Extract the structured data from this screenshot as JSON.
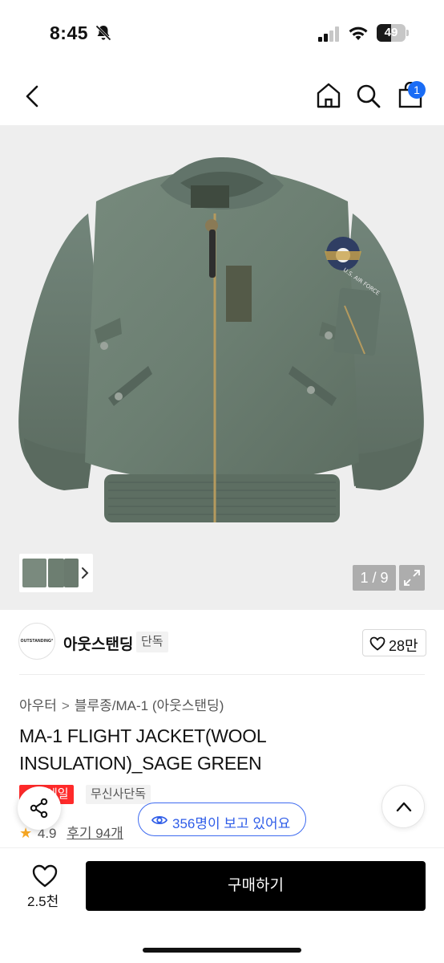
{
  "status_bar": {
    "time": "8:45",
    "battery": "49",
    "battery_level": 0.49
  },
  "nav": {
    "cart_count": "1",
    "accent_color": "#1a6cf5"
  },
  "gallery": {
    "counter": "1 / 9"
  },
  "brand": {
    "logo_text": "OUTSTANDING°",
    "name": "아웃스탠딩",
    "exclusive_badge": "단독",
    "likes": "28만"
  },
  "breadcrumb": {
    "level1": "아우터",
    "separator": ">",
    "level2": "블루종/MA-1 (아웃스탠딩)"
  },
  "product": {
    "title": "MA-1 FLIGHT JACKET(WOOL INSULATION)_SAGE GREEN",
    "sale_tag": "세일",
    "exclusive_tag": "무신사단독",
    "rating_star": "★",
    "rating": "4.9",
    "reviews": "후기 94개"
  },
  "viewers": {
    "text": "356명이 보고 있어요"
  },
  "bottom_bar": {
    "like_count": "2.5천",
    "buy_label": "구매하기"
  },
  "colors": {
    "sale": "#ff2a2a",
    "viewer_pill": "#2f5de8",
    "buy_button": "#000000",
    "star": "#f5a623"
  }
}
